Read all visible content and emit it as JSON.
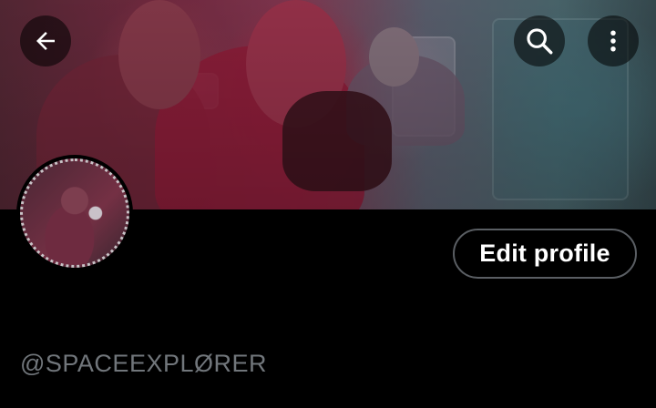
{
  "header": {
    "back_icon": "arrow-left-icon",
    "search_icon": "search-icon",
    "more_icon": "more-vertical-icon"
  },
  "profile": {
    "edit_button_label": "Edit profile",
    "handle": "@SPACEEXPLØRER"
  },
  "colors": {
    "background": "#000000",
    "handle_text": "#71767b",
    "button_border": "#5a5e63"
  }
}
